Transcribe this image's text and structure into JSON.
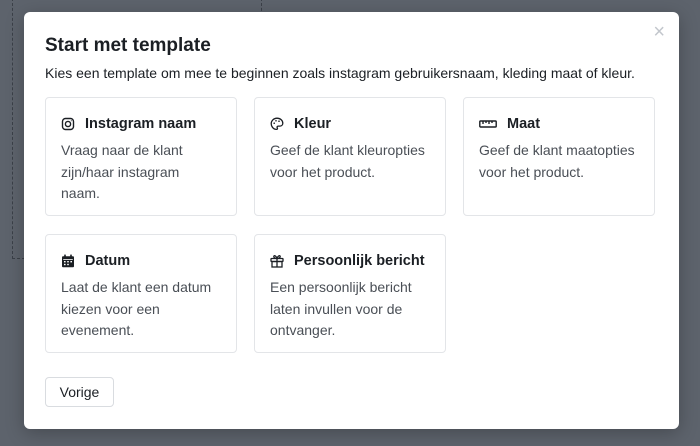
{
  "modal": {
    "title": "Start met template",
    "subtitle": "Kies een template om mee te beginnen zoals instagram gebruikersnaam, kleding maat of kleur.",
    "close_icon": "×"
  },
  "templates": [
    {
      "icon": "instagram-icon",
      "title": "Instagram naam",
      "desc": "Vraag naar de klant zijn/haar instagram naam."
    },
    {
      "icon": "palette-icon",
      "title": "Kleur",
      "desc": "Geef de klant kleuropties voor het product."
    },
    {
      "icon": "ruler-icon",
      "title": "Maat",
      "desc": "Geef de klant maatopties voor het product."
    },
    {
      "icon": "calendar-icon",
      "title": "Datum",
      "desc": "Laat de klant een datum kiezen voor een evenement."
    },
    {
      "icon": "gift-icon",
      "title": "Persoonlijk bericht",
      "desc": "Een persoonlijk bericht laten invullen voor de ontvanger."
    }
  ],
  "footer": {
    "back_label": "Vorige"
  }
}
